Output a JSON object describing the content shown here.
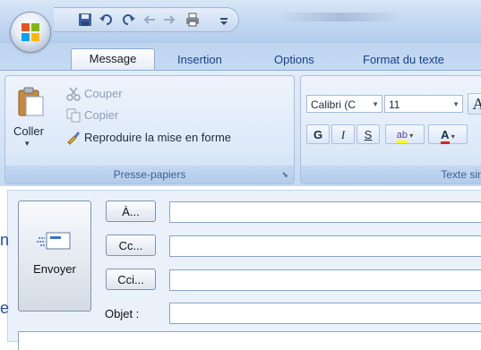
{
  "quick_access": {
    "icons": [
      "save-icon",
      "undo-icon",
      "redo-icon",
      "back-arrow-icon",
      "forward-arrow-icon",
      "print-icon",
      "customize-dropdown-icon"
    ]
  },
  "tabs": [
    {
      "label": "Message",
      "active": true
    },
    {
      "label": "Insertion",
      "active": false
    },
    {
      "label": "Options",
      "active": false
    },
    {
      "label": "Format du texte",
      "active": false
    }
  ],
  "clipboard": {
    "paste_label": "Coller",
    "cut_label": "Couper",
    "copy_label": "Copier",
    "format_painter_label": "Reproduire la mise en forme",
    "group_label": "Presse-papiers"
  },
  "basic_text": {
    "font_name": "Calibri (C",
    "font_size": "11",
    "bold_label": "G",
    "italic_label": "I",
    "underline_label": "S",
    "highlight_label": "ab",
    "font_color_label": "A",
    "grow_font_label": "A",
    "group_label": "Texte sim"
  },
  "compose": {
    "send_label": "Envoyer",
    "to_label": "À...",
    "cc_label": "Cc...",
    "bcc_label": "Cci...",
    "subject_label": "Objet :",
    "to_value": "",
    "cc_value": "",
    "bcc_value": "",
    "subject_value": ""
  },
  "left_edge_fragments": [
    "n",
    "e"
  ],
  "colors": {
    "ribbon_text": "#15428b",
    "highlight": "#ffff00",
    "font_color": "#e02020"
  }
}
